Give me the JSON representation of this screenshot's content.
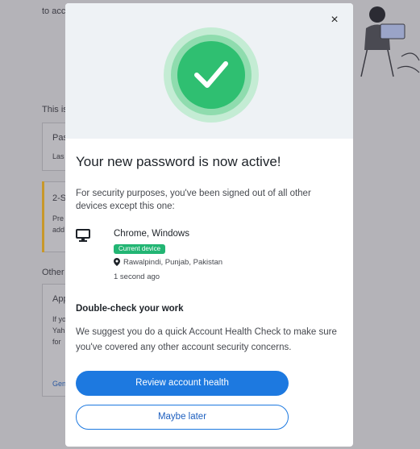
{
  "background": {
    "top_text": "to acc",
    "section1_title": "This is",
    "card1_line1": "Pas",
    "card1_line2": "Las",
    "card2_line1": "2-S",
    "card2_line2": "Pre",
    "card2_line3": "add",
    "section2_title": "Other",
    "card3_line1": "App",
    "card3_line2": "If yo",
    "card3_line3": "Yah",
    "card3_line4": "for",
    "card3_link": "Gen"
  },
  "modal": {
    "close_label": "×",
    "title": "Your new password is now active!",
    "description": "For security purposes, you've been signed out of all other devices except this one:",
    "device": {
      "name": "Chrome, Windows",
      "badge": "Current device",
      "location": "Rawalpindi, Punjab, Pakistan",
      "time": "1 second ago"
    },
    "double_check_title": "Double-check your work",
    "double_check_text": "We suggest you do a quick Account Health Check to make sure you've covered any other account security concerns.",
    "primary_button": "Review account health",
    "secondary_button": "Maybe later"
  },
  "colors": {
    "accent": "#1d79e0",
    "success": "#2fbf71",
    "badge": "#22b573"
  }
}
